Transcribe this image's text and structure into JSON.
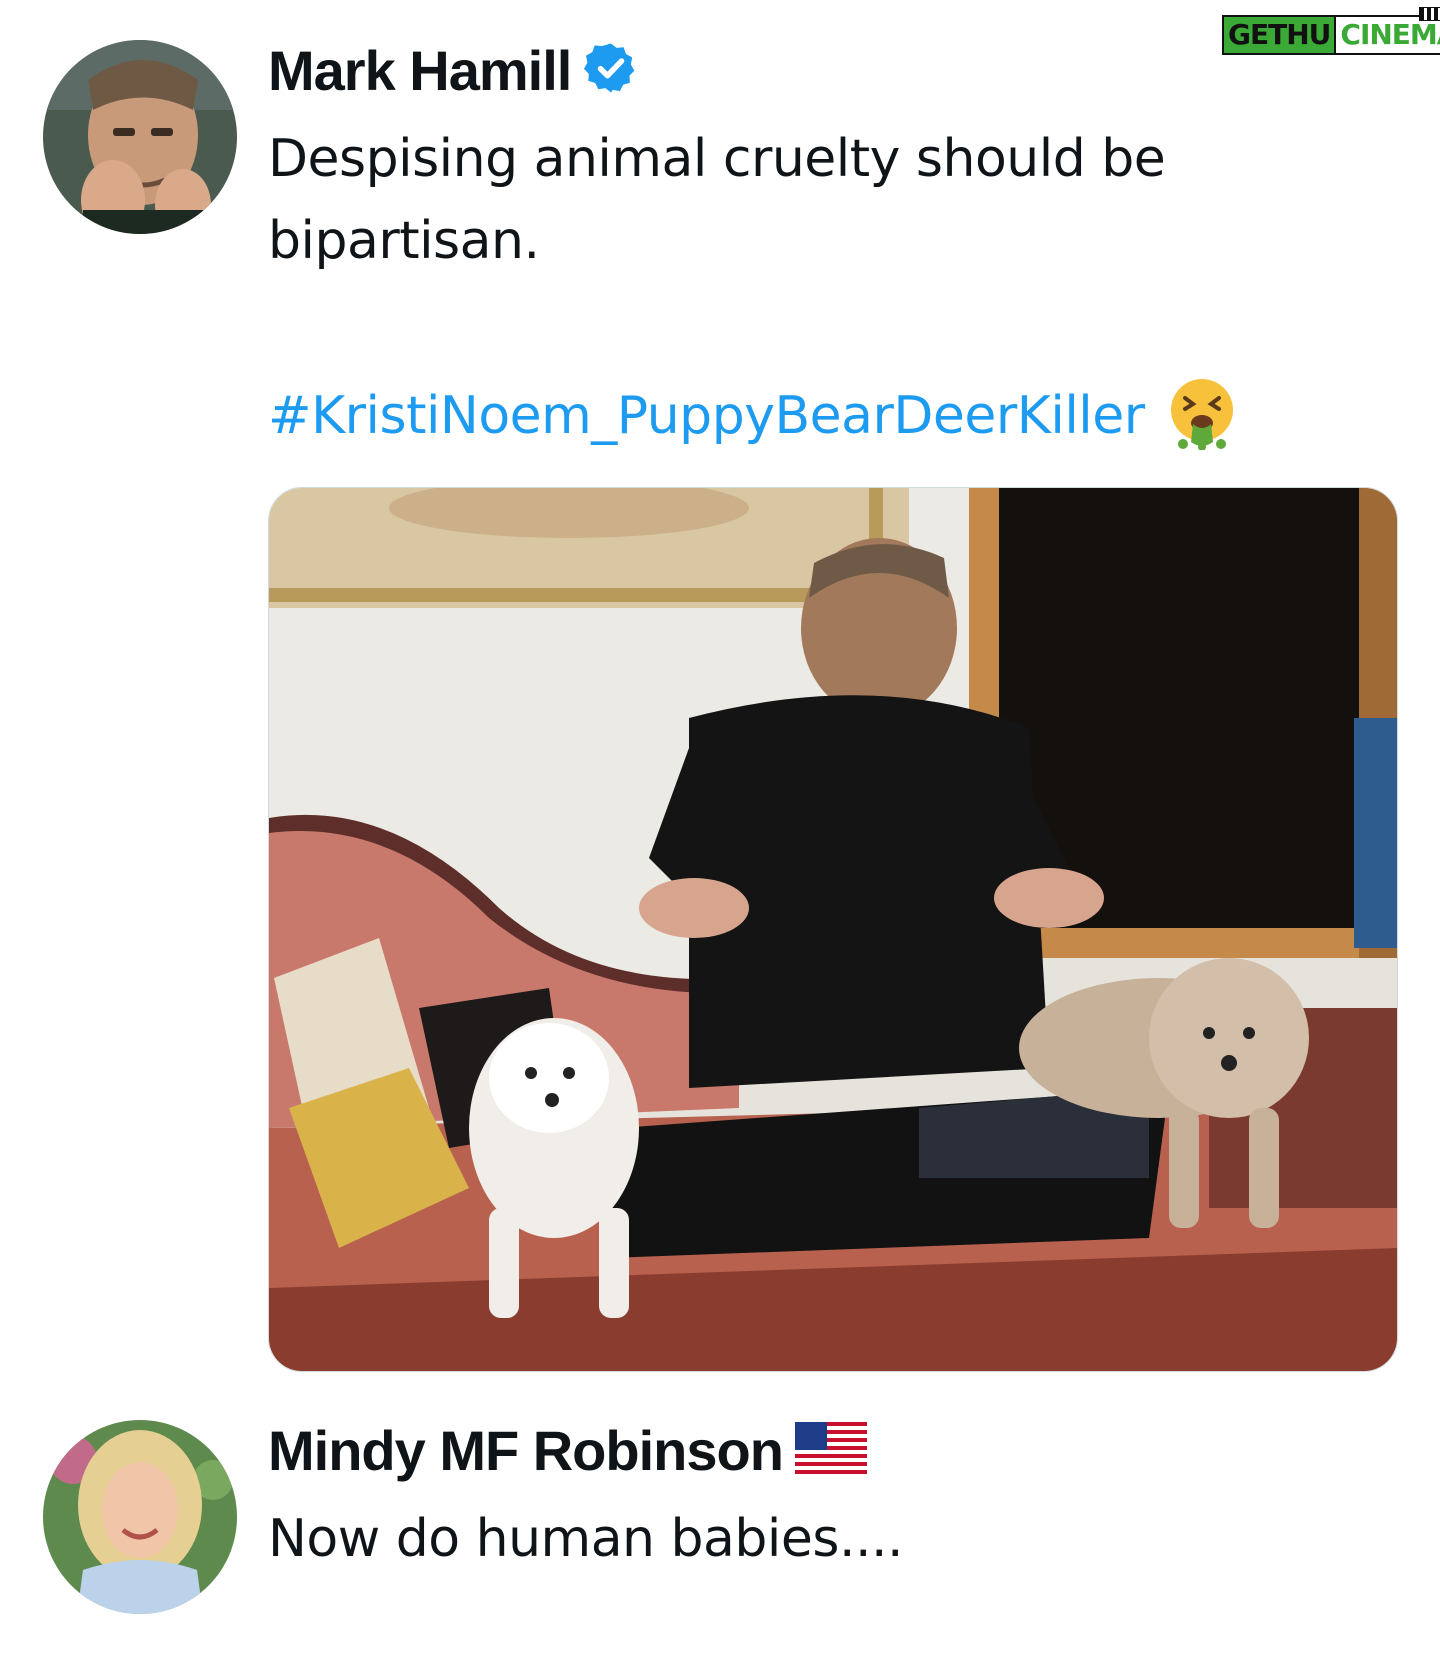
{
  "watermark": {
    "left_text": "GETHU",
    "right_text": "CINEMA"
  },
  "tweet": {
    "author_name": "Mark Hamill",
    "verified": true,
    "text_line1": "Despising animal cruelty should be",
    "text_line2": "bipartisan.",
    "hashtag": "#KristiNoem_PuppyBearDeerKiller",
    "emoji": "🤮",
    "media": {
      "type": "photo",
      "rounded": true
    },
    "avatar_icon": "profile-photo"
  },
  "reply": {
    "author_name": "Mindy MF Robinson",
    "flag": "us-flag",
    "text": "Now do human babies....",
    "avatar_icon": "profile-photo"
  },
  "colors": {
    "text": "#0f1419",
    "link": "#1d9bf0",
    "verified": "#1d9bf0",
    "background": "#ffffff",
    "watermark_green": "#3aa935"
  }
}
